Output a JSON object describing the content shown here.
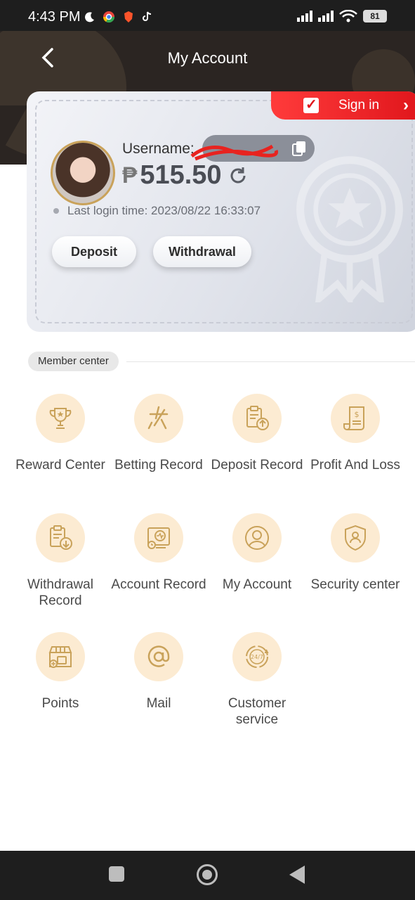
{
  "status_bar": {
    "time": "4:43 PM",
    "battery": "81"
  },
  "header": {
    "title": "My Account"
  },
  "card": {
    "sign_in_label": "Sign in",
    "username_label": "Username:",
    "balance_currency": "₱",
    "balance": "515.50",
    "last_login": "Last login time: 2023/08/22 16:33:07",
    "deposit_label": "Deposit",
    "withdrawal_label": "Withdrawal"
  },
  "member_center": {
    "label": "Member center",
    "items": [
      {
        "label": "Reward Center",
        "icon": "trophy-icon"
      },
      {
        "label": "Betting Record",
        "icon": "betting-icon"
      },
      {
        "label": "Deposit Record",
        "icon": "deposit-record-icon"
      },
      {
        "label": "Profit And Loss",
        "icon": "profit-loss-icon"
      },
      {
        "label": "Withdrawal Record",
        "icon": "withdrawal-record-icon"
      },
      {
        "label": "Account Record",
        "icon": "account-record-icon"
      },
      {
        "label": "My Account",
        "icon": "user-icon"
      },
      {
        "label": "Security center",
        "icon": "shield-icon"
      },
      {
        "label": "Points",
        "icon": "points-icon"
      },
      {
        "label": "Mail",
        "icon": "mail-icon"
      },
      {
        "label": "Customer service",
        "icon": "support-24-7-icon"
      }
    ]
  },
  "colors": {
    "accent": "#e0161c",
    "icon_bg": "#fcebd2",
    "icon_stroke": "#c9a25a",
    "header_bg": "#2b2522"
  }
}
